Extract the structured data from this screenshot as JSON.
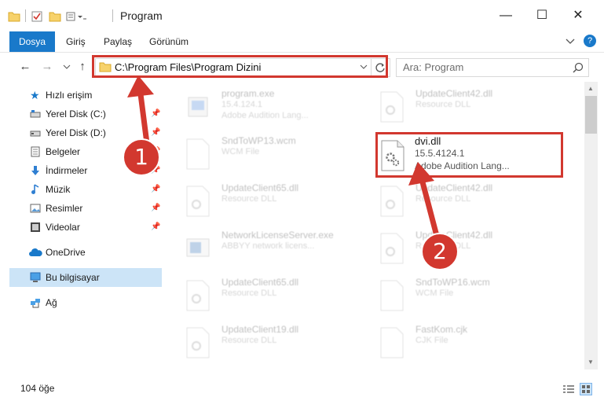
{
  "window": {
    "title": "Program",
    "controls": {
      "minimize": "—",
      "maximize": "☐",
      "close": "✕"
    }
  },
  "ribbon": {
    "tabs": [
      "Dosya",
      "Giriş",
      "Paylaş",
      "Görünüm"
    ],
    "collapse_icon": "chevron-down-icon",
    "help_icon": "?"
  },
  "address": {
    "path": "C:\\Program Files\\Program Dizini",
    "search_placeholder": "Ara: Program"
  },
  "nav": {
    "quick_access": "Hızlı erişim",
    "items": [
      {
        "label": "Yerel Disk (C:)",
        "icon": "drive-icon",
        "pinned": true
      },
      {
        "label": "Yerel Disk (D:)",
        "icon": "drive-icon",
        "pinned": true
      },
      {
        "label": "Belgeler",
        "icon": "documents-icon",
        "pinned": true
      },
      {
        "label": "İndirmeler",
        "icon": "download-icon",
        "pinned": true
      },
      {
        "label": "Müzik",
        "icon": "music-icon",
        "pinned": true
      },
      {
        "label": "Resimler",
        "icon": "pictures-icon",
        "pinned": true
      },
      {
        "label": "Videolar",
        "icon": "videos-icon",
        "pinned": true
      }
    ],
    "onedrive": "OneDrive",
    "this_pc": "Bu bilgisayar",
    "network": "Ağ"
  },
  "files": [
    {
      "name": "program.exe",
      "version": "15.4.124.1",
      "desc": "Adobe Audition Lang...",
      "icon": "exe-icon"
    },
    {
      "name": "UpdateClient42.dll",
      "version": "Resource DLL",
      "desc": "",
      "icon": "dll-icon"
    },
    {
      "name": "SndToWP13.wcm",
      "version": "WCM File",
      "desc": "",
      "icon": "file-icon"
    },
    {
      "name": "dvi.dll",
      "version": "15.5.4124.1",
      "desc": "Adobe Audition Lang...",
      "icon": "dll-icon"
    },
    {
      "name": "UpdateClient65.dll",
      "version": "Resource DLL",
      "desc": "",
      "icon": "dll-icon"
    },
    {
      "name": "UpdateClient42.dll",
      "version": "Resource DLL",
      "desc": "",
      "icon": "dll-icon"
    },
    {
      "name": "NetworkLicenseServer.exe",
      "version": "ABBYY network licens...",
      "desc": "",
      "icon": "exe-icon"
    },
    {
      "name": "UpdateClient42.dll",
      "version": "Resource DLL",
      "desc": "",
      "icon": "dll-icon"
    },
    {
      "name": "UpdateClient65.dll",
      "version": "Resource DLL",
      "desc": "",
      "icon": "dll-icon"
    },
    {
      "name": "SndToWP16.wcm",
      "version": "WCM File",
      "desc": "",
      "icon": "file-icon"
    },
    {
      "name": "UpdateClient19.dll",
      "version": "Resource DLL",
      "desc": "",
      "icon": "dll-icon"
    },
    {
      "name": "FastKom.cjk",
      "version": "CJK File",
      "desc": "",
      "icon": "file-icon"
    }
  ],
  "status": {
    "count": "104 öğe"
  },
  "annotations": {
    "badge1": "1",
    "badge2": "2",
    "accent": "#d2382f"
  }
}
